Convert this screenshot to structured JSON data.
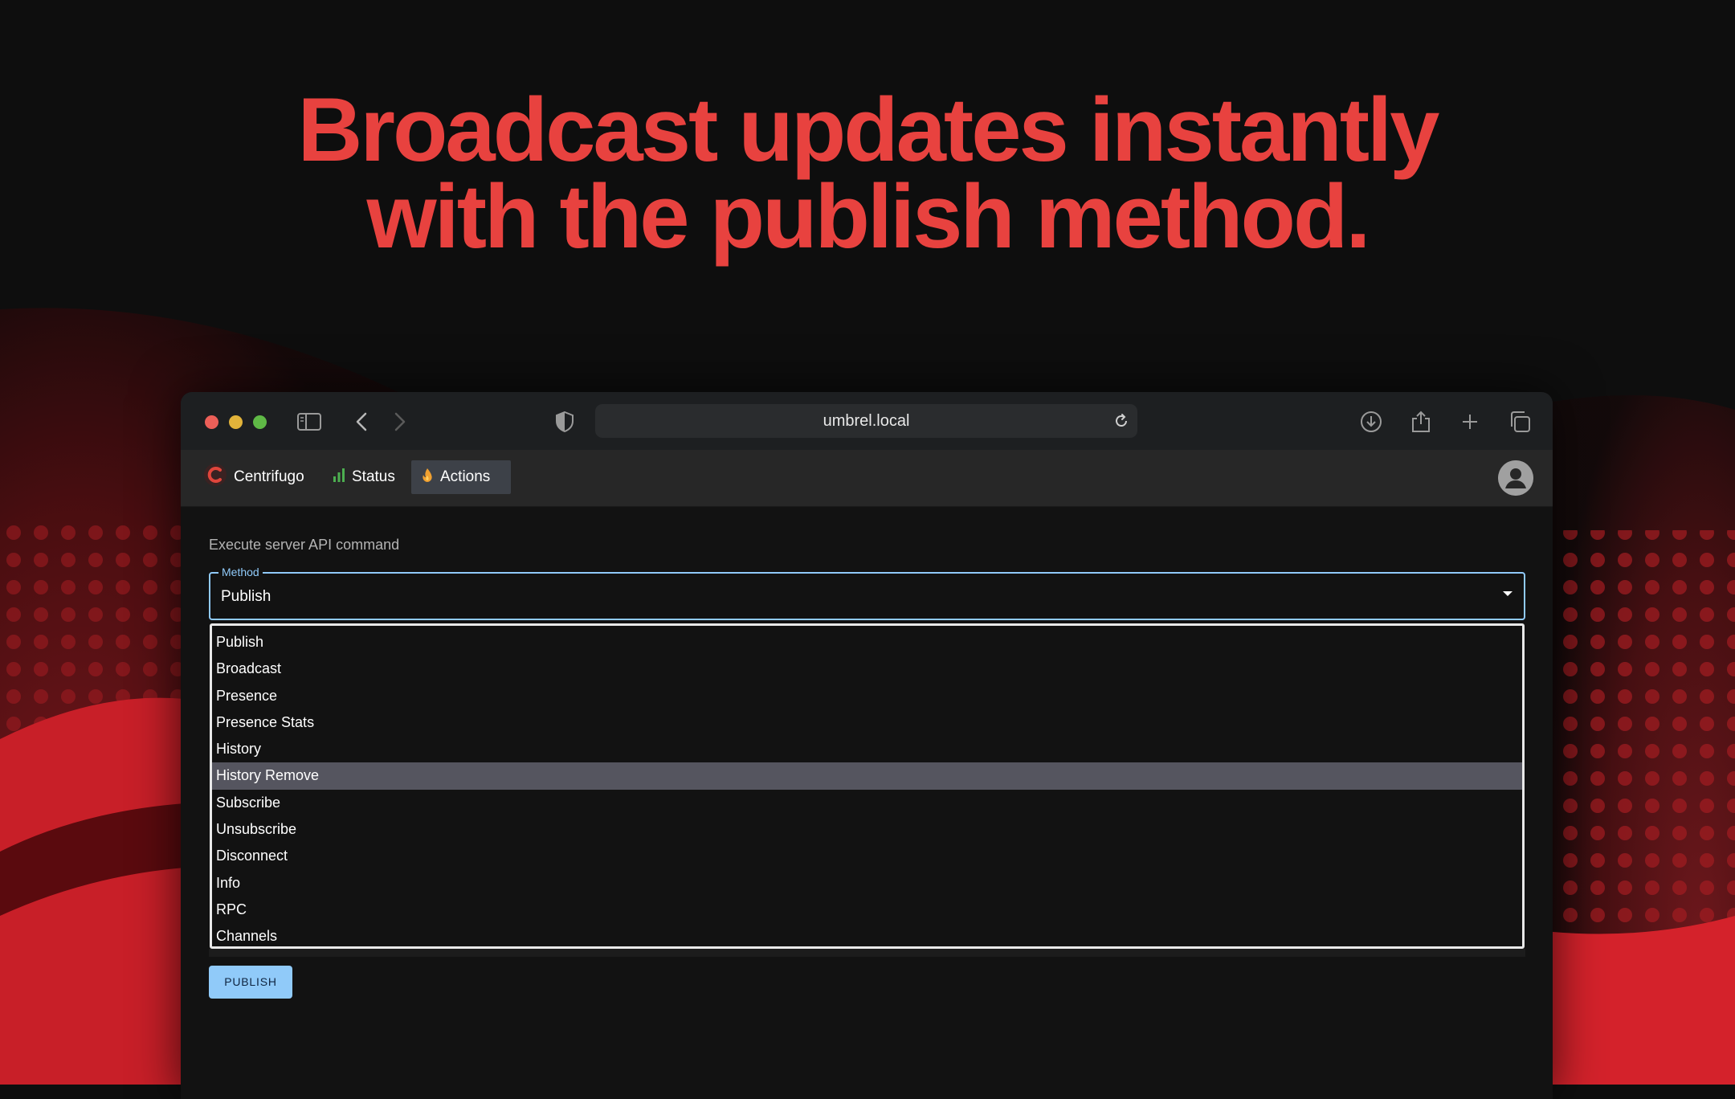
{
  "headline": {
    "line1": "Broadcast updates instantly",
    "line2": "with the publish method."
  },
  "browser": {
    "url": "umbrel.local"
  },
  "app": {
    "brand": "Centrifugo",
    "nav": [
      {
        "label": "Status",
        "icon": "bar-chart-icon"
      },
      {
        "label": "Actions",
        "icon": "fire-icon"
      }
    ]
  },
  "form": {
    "section_title": "Execute server API command",
    "method_label": "Method",
    "method_value": "Publish",
    "options": [
      "Publish",
      "Broadcast",
      "Presence",
      "Presence Stats",
      "History",
      "History Remove",
      "Subscribe",
      "Unsubscribe",
      "Disconnect",
      "Info",
      "RPC",
      "Channels"
    ],
    "highlighted_option": "History Remove",
    "submit_label": "PUBLISH"
  },
  "colors": {
    "headline": "#e8423f",
    "accent": "#90caf9",
    "app_background": "#121212"
  }
}
